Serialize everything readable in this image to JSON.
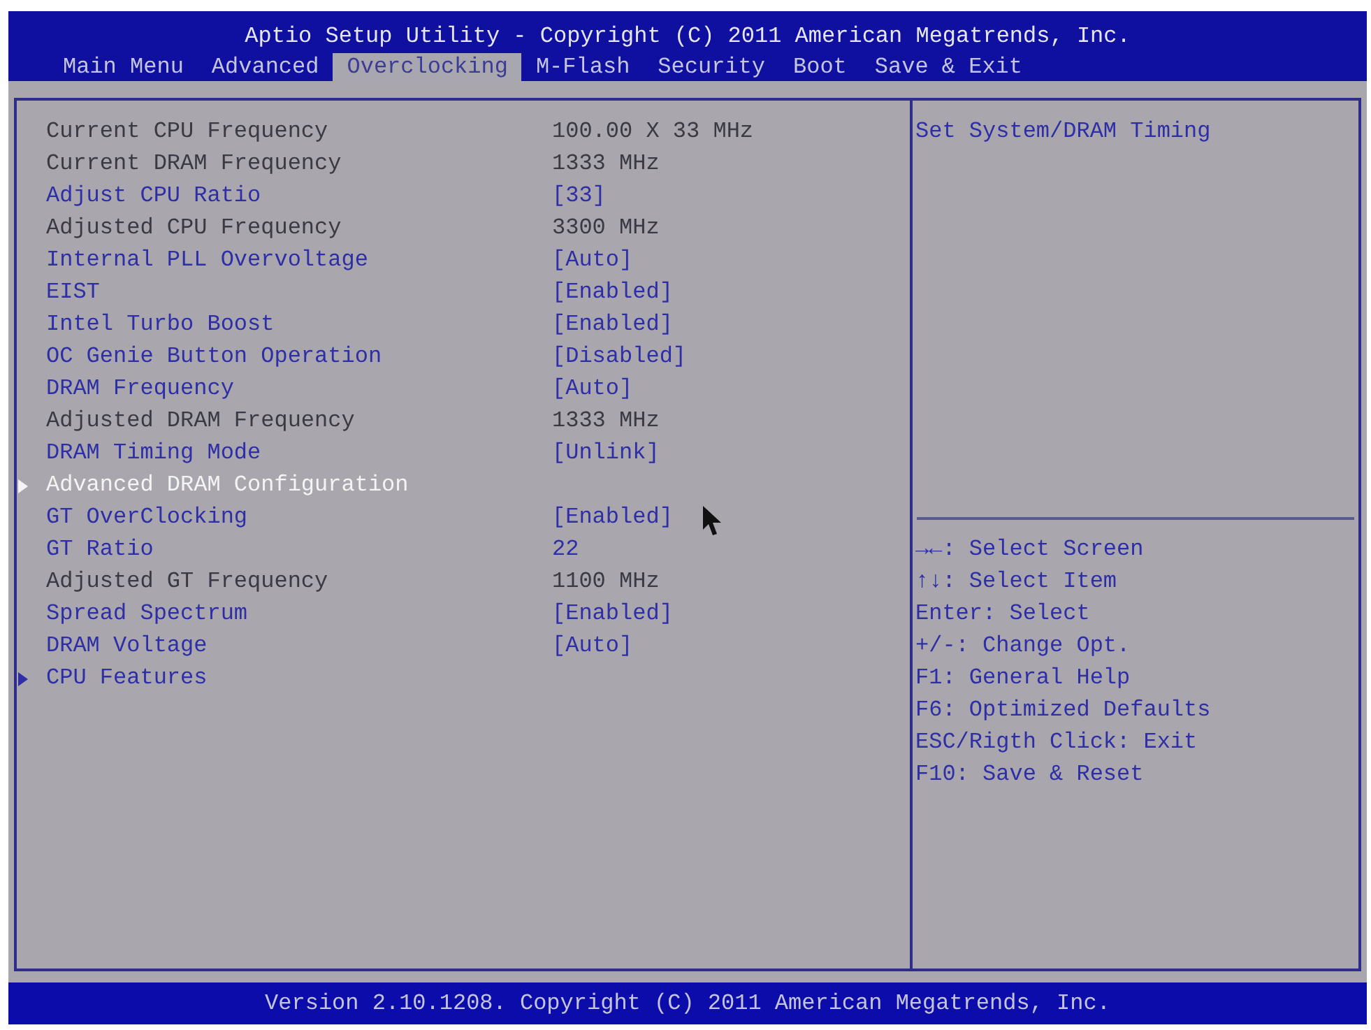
{
  "header": {
    "title": "Aptio Setup Utility - Copyright (C) 2011 American Megatrends, Inc."
  },
  "tabs": [
    {
      "label": "Main Menu",
      "selected": false
    },
    {
      "label": "Advanced",
      "selected": false
    },
    {
      "label": "Overclocking",
      "selected": true
    },
    {
      "label": "M-Flash",
      "selected": false
    },
    {
      "label": "Security",
      "selected": false
    },
    {
      "label": "Boot",
      "selected": false
    },
    {
      "label": "Save & Exit",
      "selected": false
    }
  ],
  "settings": [
    {
      "kind": "info",
      "label": "Current CPU Frequency",
      "value": "100.00 X 33 MHz",
      "selected": false
    },
    {
      "kind": "info",
      "label": "Current DRAM Frequency",
      "value": "1333 MHz",
      "selected": false
    },
    {
      "kind": "option",
      "label": "Adjust CPU Ratio",
      "value": "[33]",
      "selected": false
    },
    {
      "kind": "info",
      "label": "Adjusted CPU Frequency",
      "value": "3300 MHz",
      "selected": false
    },
    {
      "kind": "option",
      "label": "Internal PLL Overvoltage",
      "value": "[Auto]",
      "selected": false
    },
    {
      "kind": "option",
      "label": "EIST",
      "value": "[Enabled]",
      "selected": false
    },
    {
      "kind": "option",
      "label": "Intel Turbo Boost",
      "value": "[Enabled]",
      "selected": false
    },
    {
      "kind": "option",
      "label": "OC Genie Button Operation",
      "value": "[Disabled]",
      "selected": false
    },
    {
      "kind": "option",
      "label": "DRAM Frequency",
      "value": "[Auto]",
      "selected": false
    },
    {
      "kind": "info",
      "label": "Adjusted DRAM Frequency",
      "value": "1333 MHz",
      "selected": false
    },
    {
      "kind": "option",
      "label": "DRAM Timing Mode",
      "value": "[Unlink]",
      "selected": false
    },
    {
      "kind": "submenu",
      "label": "Advanced DRAM Configuration",
      "selected": true
    },
    {
      "kind": "option",
      "label": "GT OverClocking",
      "value": "[Enabled]",
      "selected": false
    },
    {
      "kind": "option",
      "label": "GT Ratio",
      "value": "22",
      "selected": false
    },
    {
      "kind": "info",
      "label": "Adjusted GT Frequency",
      "value": "1100 MHz",
      "selected": false
    },
    {
      "kind": "option",
      "label": "Spread Spectrum",
      "value": "[Enabled]",
      "selected": false
    },
    {
      "kind": "option",
      "label": "DRAM Voltage",
      "value": "[Auto]",
      "selected": false
    },
    {
      "kind": "submenu",
      "label": "CPU Features",
      "selected": false
    }
  ],
  "help": {
    "description": "Set System/DRAM Timing",
    "keys": [
      "→←: Select Screen",
      "↑↓: Select Item",
      "Enter: Select",
      "+/-: Change Opt.",
      "F1: General Help",
      "F6: Optimized Defaults",
      "ESC/Rigth Click: Exit",
      "F10: Save & Reset"
    ]
  },
  "footer": {
    "text": "Version 2.10.1208. Copyright (C) 2011 American Megatrends, Inc."
  }
}
